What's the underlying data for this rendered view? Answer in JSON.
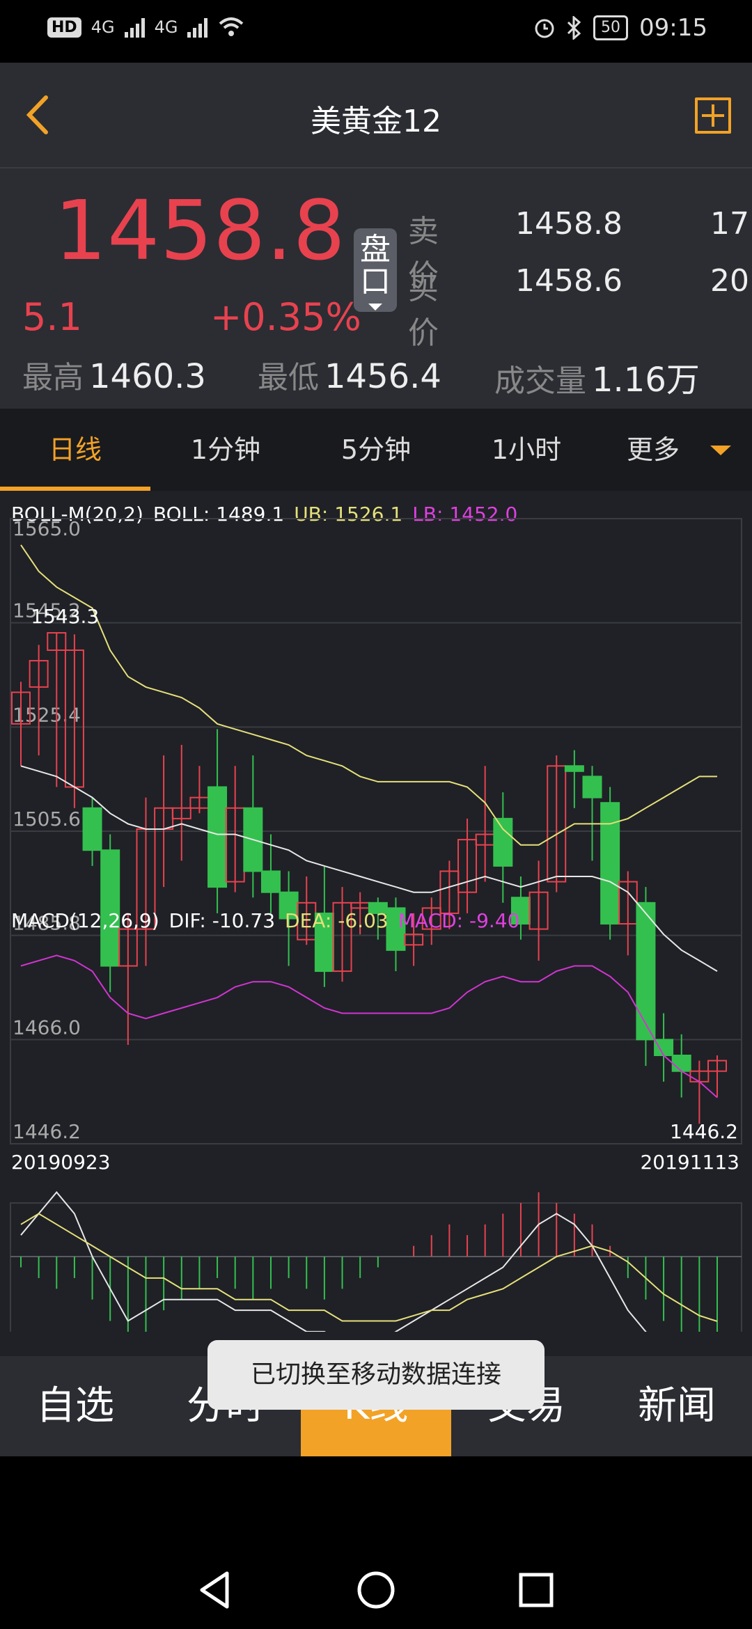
{
  "status_bar": {
    "hd": "HD",
    "net1": "4G",
    "net2": "4G",
    "battery": "50",
    "time": "09:15"
  },
  "header": {
    "title": "美黄金12"
  },
  "quote": {
    "price": "1458.8",
    "change": "5.1",
    "change_pct": "+0.35%",
    "orderbook_button": "盘口",
    "ask_label": "卖价",
    "ask_price": "1458.8",
    "ask_vol": "17",
    "bid_label": "买价",
    "bid_price": "1458.6",
    "bid_vol": "20",
    "high_label": "最高",
    "high": "1460.3",
    "low_label": "最低",
    "low": "1456.4",
    "volume_label": "成交量",
    "volume": "1.16万"
  },
  "tabs": [
    "日线",
    "1分钟",
    "5分钟",
    "1小时",
    "更多"
  ],
  "boll_legend": {
    "name": "BOLL-M(20,2)",
    "boll": "BOLL: 1489.1",
    "ub": "UB: 1526.1",
    "lb": "LB: 1452.0"
  },
  "macd_legend": {
    "name": "MACD(12,26,9)",
    "dif": "DIF: -10.73",
    "dea": "DEA: -6.03",
    "macd": "MACD: -9.40"
  },
  "chart_data": {
    "type": "candlestick",
    "y_ticks": [
      "1565.0",
      "1545.2",
      "1525.4",
      "1505.6",
      "1485.8",
      "1466.0",
      "1446.2"
    ],
    "ylim": [
      1446.2,
      1565.0
    ],
    "max_label": "1543.3",
    "min_label": "1446.2",
    "date_start": "20190923",
    "date_end": "20191113",
    "candles": [
      [
        1526,
        1532,
        1518,
        1534
      ],
      [
        1533,
        1538,
        1520,
        1541
      ],
      [
        1540,
        1543.3,
        1514,
        1543.3
      ],
      [
        1514,
        1540,
        1510,
        1543
      ],
      [
        1510,
        1502,
        1499,
        1512
      ],
      [
        1502,
        1480,
        1475,
        1505
      ],
      [
        1480,
        1487,
        1465,
        1490
      ],
      [
        1487,
        1506,
        1480,
        1512
      ],
      [
        1506,
        1510,
        1495,
        1520
      ],
      [
        1508,
        1510,
        1500,
        1522
      ],
      [
        1510,
        1512,
        1509,
        1518
      ],
      [
        1514,
        1495,
        1490,
        1525
      ],
      [
        1496,
        1510,
        1494,
        1518
      ],
      [
        1510,
        1498,
        1493,
        1520
      ],
      [
        1498,
        1494,
        1490,
        1505
      ],
      [
        1494,
        1489,
        1480,
        1498
      ],
      [
        1485,
        1492,
        1484,
        1497
      ],
      [
        1490,
        1479,
        1476,
        1499
      ],
      [
        1479,
        1492,
        1477,
        1495
      ],
      [
        1491,
        1492,
        1486,
        1494
      ],
      [
        1492,
        1490,
        1485,
        1493
      ],
      [
        1491,
        1483,
        1479,
        1493
      ],
      [
        1484,
        1486,
        1480,
        1490
      ],
      [
        1487,
        1491,
        1484,
        1493
      ],
      [
        1490,
        1498,
        1487,
        1500
      ],
      [
        1494,
        1504,
        1490,
        1508
      ],
      [
        1503,
        1505,
        1496,
        1518
      ],
      [
        1508,
        1499,
        1492,
        1513
      ],
      [
        1493,
        1488,
        1485,
        1497
      ],
      [
        1487,
        1494,
        1481,
        1500
      ],
      [
        1496,
        1518,
        1494,
        1520
      ],
      [
        1518,
        1517,
        1510,
        1521
      ],
      [
        1516,
        1512,
        1500,
        1518
      ],
      [
        1511,
        1488,
        1485,
        1514
      ],
      [
        1488,
        1496,
        1482,
        1498
      ],
      [
        1492,
        1466,
        1461,
        1495
      ],
      [
        1466,
        1463,
        1458,
        1471
      ],
      [
        1463,
        1460,
        1455,
        1467
      ],
      [
        1458,
        1460,
        1450,
        1462
      ],
      [
        1460,
        1462,
        1455,
        1463
      ]
    ],
    "ub_line": [
      1560,
      1555,
      1552,
      1550,
      1548,
      1540,
      1535,
      1533,
      1532,
      1531,
      1529,
      1526,
      1525,
      1524,
      1523,
      1522,
      1520,
      1519,
      1518,
      1516,
      1515,
      1515,
      1515,
      1515,
      1515,
      1514,
      1511,
      1506,
      1503,
      1503,
      1505,
      1507,
      1507,
      1507,
      1508,
      1510,
      1512,
      1514,
      1516,
      1516
    ],
    "mid_line": [
      1518,
      1517,
      1516,
      1514,
      1512,
      1509,
      1507,
      1506,
      1506,
      1507,
      1506,
      1505,
      1505,
      1504,
      1503,
      1502,
      1500,
      1499,
      1498,
      1497,
      1496,
      1495,
      1494,
      1494,
      1495,
      1496,
      1497,
      1496,
      1495,
      1496,
      1497,
      1497,
      1497,
      1496,
      1494,
      1490,
      1486,
      1483,
      1481,
      1479
    ],
    "lb_line": [
      1480,
      1481,
      1482,
      1481,
      1479,
      1474,
      1471,
      1470,
      1471,
      1472,
      1473,
      1474,
      1476,
      1477,
      1477,
      1476,
      1474,
      1472,
      1471,
      1471,
      1471,
      1471,
      1471,
      1471,
      1472,
      1475,
      1477,
      1478,
      1477,
      1477,
      1479,
      1480,
      1480,
      1478,
      1475,
      1469,
      1463,
      1460,
      1458,
      1455
    ],
    "macd_hist": [
      -1,
      -2,
      -3,
      -2,
      -4,
      -6,
      -9,
      -7,
      -5,
      -4,
      -3,
      -2,
      -3,
      -4,
      -3,
      -2,
      -3,
      -4,
      -3,
      -2,
      -1,
      0,
      1,
      2,
      3,
      2,
      3,
      4,
      5,
      6,
      5,
      4,
      3,
      1,
      -2,
      -4,
      -6,
      -8,
      -9,
      -9.4
    ],
    "dif_line": [
      2,
      4,
      6,
      4,
      0,
      -3,
      -6,
      -5,
      -4,
      -4,
      -4,
      -4,
      -5,
      -5,
      -5,
      -6,
      -7,
      -7,
      -8,
      -8,
      -8,
      -7,
      -6,
      -5,
      -4,
      -3,
      -2,
      -1,
      1,
      3,
      4,
      3,
      1,
      -2,
      -5,
      -7,
      -9,
      -10,
      -10.5,
      -10.73
    ],
    "dea_line": [
      3,
      4,
      3,
      2,
      1,
      0,
      -1,
      -2,
      -2,
      -3,
      -3,
      -3,
      -4,
      -4,
      -4,
      -5,
      -5,
      -5,
      -6,
      -6,
      -6,
      -6,
      -5.5,
      -5,
      -5,
      -4,
      -3.5,
      -3,
      -2,
      -1,
      0,
      0.5,
      1,
      0.5,
      -0.5,
      -2,
      -3.5,
      -4.5,
      -5.5,
      -6.03
    ]
  },
  "bottom_nav": [
    "自选",
    "分时",
    "K线",
    "交易",
    "新闻"
  ],
  "toast": "已切换至移动数据连接"
}
